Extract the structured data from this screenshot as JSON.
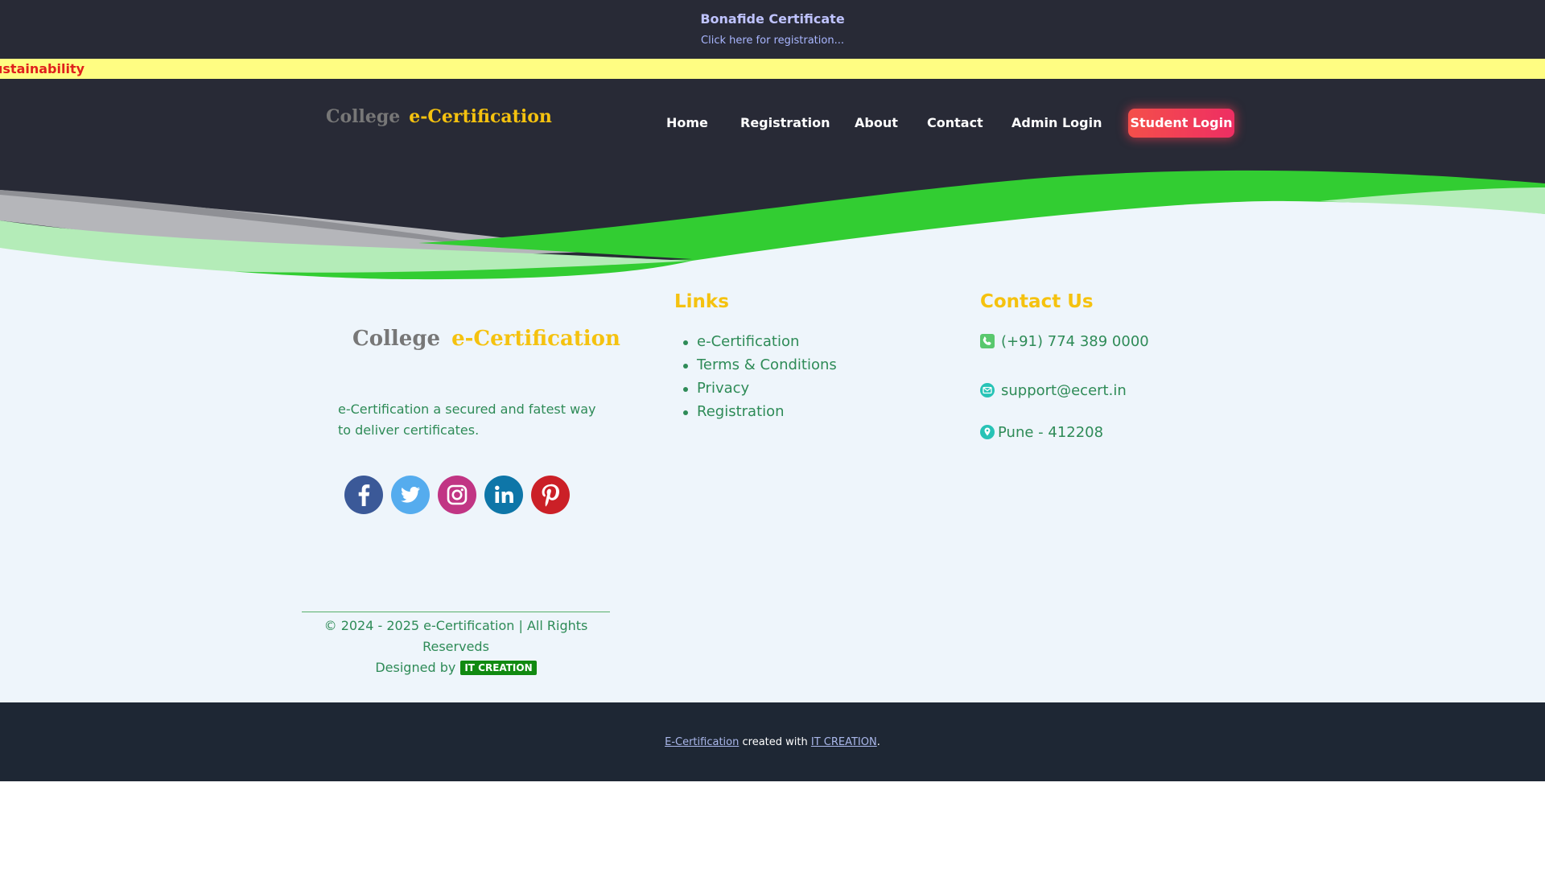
{
  "announcement": {
    "title": "Bonafide Certificate",
    "link": "Click here for registration..."
  },
  "marquee": {
    "text": "ustainability"
  },
  "header": {
    "brand": {
      "college": "College",
      "ecert": "e-Certification"
    },
    "nav": [
      "Home",
      "Registration",
      "About",
      "Contact",
      "Admin Login"
    ],
    "login_button": "Student Login"
  },
  "footer": {
    "brand": {
      "college": "College",
      "ecert": "e-Certification"
    },
    "about": "e-Certification a secured and fatest way to deliver certificates.",
    "socials": [
      "facebook-icon",
      "twitter-icon",
      "instagram-icon",
      "linkedin-icon",
      "pinterest-icon"
    ],
    "links_title": "Links",
    "links": [
      "e-Certification",
      "Terms & Conditions",
      "Privacy",
      "Registration"
    ],
    "contact_title": "Contact Us",
    "contact": {
      "phone": "(+91) 774 389 0000",
      "email": "support@ecert.in",
      "location": "Pune - 412208"
    },
    "copyright": "© 2024 - 2025 e-Certification | All Rights Reserveds",
    "designed_by": "Designed by",
    "designer_badge": "IT CREATION"
  },
  "bottom_bar": {
    "site_link": "E-Certification",
    "created_with": "created with",
    "creator_link": "IT CREATION",
    "period": "."
  },
  "colors": {
    "header_bg": "#282a36",
    "marquee_bg": "#fffd82",
    "marquee_text": "#e0201c",
    "brand_gold": "#f5c20f",
    "wave_green": "#32cd32",
    "footer_bg": "#eef5fb",
    "footer_text": "#2e8b57",
    "bottom_bg": "#1e2734"
  }
}
